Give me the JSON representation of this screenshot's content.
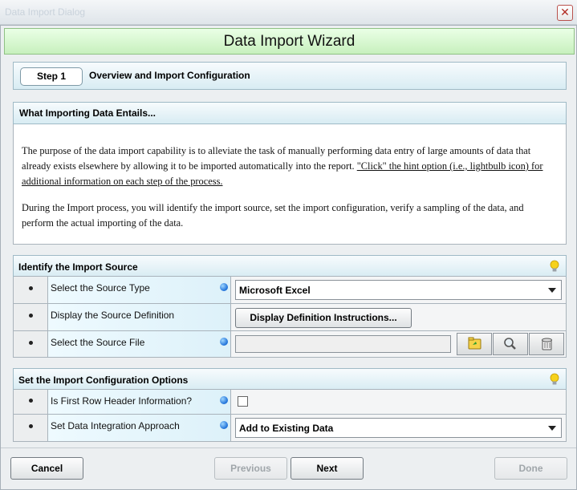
{
  "window": {
    "title": "Data Import Dialog"
  },
  "header": {
    "title": "Data Import Wizard"
  },
  "step": {
    "badge": "Step 1",
    "title": "Overview and Import Configuration"
  },
  "overview": {
    "heading": "What Importing Data Entails...",
    "para1_a": "The purpose of the data import capability is to alleviate the task of manually performing data entry of large amounts of data that already exists elsewhere by allowing it to be imported automatically into the report.",
    "para1_link": "\"Click\" the hint option (i.e., lightbulb icon) for additional information on each step of the process.",
    "para2": "During the Import process, you will identify the import source, set the import configuration, verify a sampling of the data, and perform the actual importing of the data."
  },
  "source": {
    "heading": "Identify the Import Source",
    "rows": [
      {
        "label": "Select the Source Type",
        "value": "Microsoft Excel"
      },
      {
        "label": "Display the Source Definition",
        "button": "Display Definition Instructions..."
      },
      {
        "label": "Select the Source File",
        "value": ""
      }
    ]
  },
  "config": {
    "heading": "Set the Import Configuration Options",
    "rows": [
      {
        "label": "Is First Row Header Information?",
        "checked": false
      },
      {
        "label": "Set Data Integration Approach",
        "value": "Add to Existing Data"
      }
    ]
  },
  "footer": {
    "cancel": "Cancel",
    "previous": "Previous",
    "next": "Next",
    "done": "Done"
  },
  "colors": {
    "header_green": "#c7f0bd",
    "section_blue": "#d8ecf3",
    "required_dot": "#1d6fd8"
  }
}
